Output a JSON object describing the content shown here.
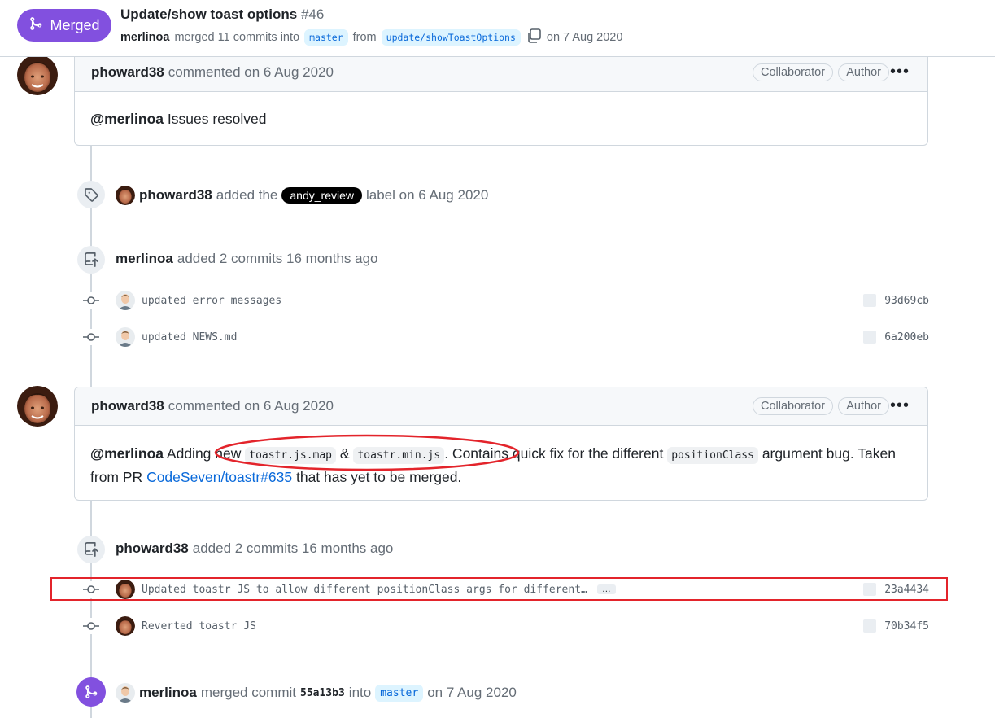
{
  "header": {
    "badge": "Merged",
    "title": "Update/show toast options",
    "number": "#46",
    "merger": "merlinoa",
    "merged_text": "merged 11 commits into",
    "base_branch": "master",
    "from_text": "from",
    "head_branch": "update/showToastOptions",
    "date_text": "on 7 Aug 2020"
  },
  "comment1": {
    "author": "phoward38",
    "meta": "commented on 6 Aug 2020",
    "role1": "Collaborator",
    "role2": "Author",
    "menu": "•••",
    "mention": "@merlinoa",
    "body": "Issues resolved"
  },
  "label_event": {
    "actor": "phoward38",
    "text1": "added the",
    "label": "andy_review",
    "text2": "label on 6 Aug 2020"
  },
  "push1": {
    "actor": "merlinoa",
    "text": "added 2 commits 16 months ago",
    "commits": [
      {
        "message": "updated error messages",
        "sha": "93d69cb"
      },
      {
        "message": "updated NEWS.md",
        "sha": "6a200eb"
      }
    ]
  },
  "comment2": {
    "author": "phoward38",
    "meta": "commented on 6 Aug 2020",
    "role1": "Collaborator",
    "role2": "Author",
    "menu": "•••",
    "mention": "@merlinoa",
    "t1": "Adding new",
    "code1": "toastr.js.map",
    "t2": "&",
    "code2": "toastr.min.js",
    "t3": ". Contains quick fix for the different",
    "code3": "positionClass",
    "t4": "argument bug. Taken",
    "t5": "from PR",
    "link": "CodeSeven/toastr#635",
    "t6": "that has yet to be merged."
  },
  "push2": {
    "actor": "phoward38",
    "text": "added 2 commits 16 months ago",
    "commits": [
      {
        "message": "Updated toastr JS to allow different positionClass args for different…",
        "sha": "23a4434",
        "expand": "…"
      },
      {
        "message": "Reverted toastr JS",
        "sha": "70b34f5"
      }
    ]
  },
  "merge_event": {
    "actor": "merlinoa",
    "text1": "merged commit",
    "commit": "55a13b3",
    "text2": "into",
    "branch": "master",
    "text3": "on 7 Aug 2020"
  },
  "colors": {
    "merged_purple": "#8250df",
    "link_blue": "#0969da",
    "annotation_red": "#e3242b"
  }
}
